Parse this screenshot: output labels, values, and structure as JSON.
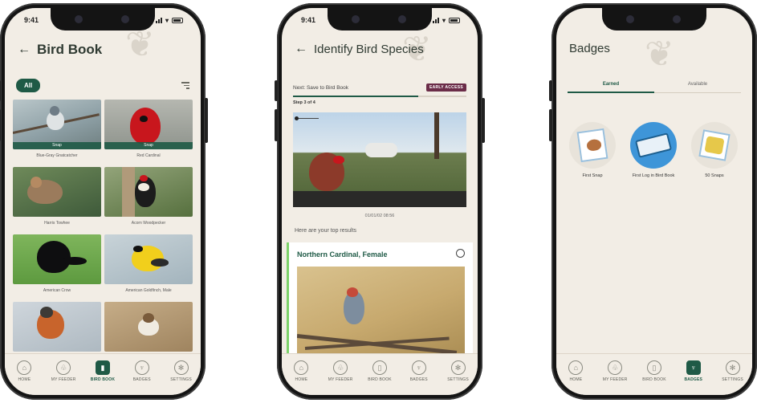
{
  "colors": {
    "accent": "#1f5a46",
    "background": "#f2ede5",
    "early_access": "#6b2c48",
    "result_border": "#7ed36b"
  },
  "status_bar": {
    "time": "9:41"
  },
  "tabbar": [
    {
      "label": "HOME",
      "icon": "home-icon"
    },
    {
      "label": "MY FEEDER",
      "icon": "feeder-icon"
    },
    {
      "label": "BIRD BOOK",
      "icon": "book-icon"
    },
    {
      "label": "BADGES",
      "icon": "trophy-icon"
    },
    {
      "label": "SETTINGS",
      "icon": "gear-icon"
    }
  ],
  "bird_book": {
    "title": "Bird Book",
    "filter_label": "All",
    "snap_label": "Snap",
    "birds": [
      "Blue-Gray Gnatcatcher",
      "Red Cardinal",
      "Harris Towhee",
      "Acorn Woodpecker",
      "American Crow",
      "American Goldfinch, Male",
      "",
      ""
    ]
  },
  "identify": {
    "title": "Identify Bird Species",
    "next_label": "Next: Save to Bird Book",
    "early_access": "EARLY ACCESS",
    "progress": 0.72,
    "step": "Step 3 of 4",
    "timestamp": "01/01/02  08:56",
    "results_text": "Here are your top results",
    "result_name": "Northern Cardinal, Female"
  },
  "badges": {
    "title": "Badges",
    "tabs": [
      "Earned",
      "Available"
    ],
    "hint": "",
    "items": [
      "First Snap",
      "First Log in Bird Book",
      "50 Snaps"
    ]
  }
}
